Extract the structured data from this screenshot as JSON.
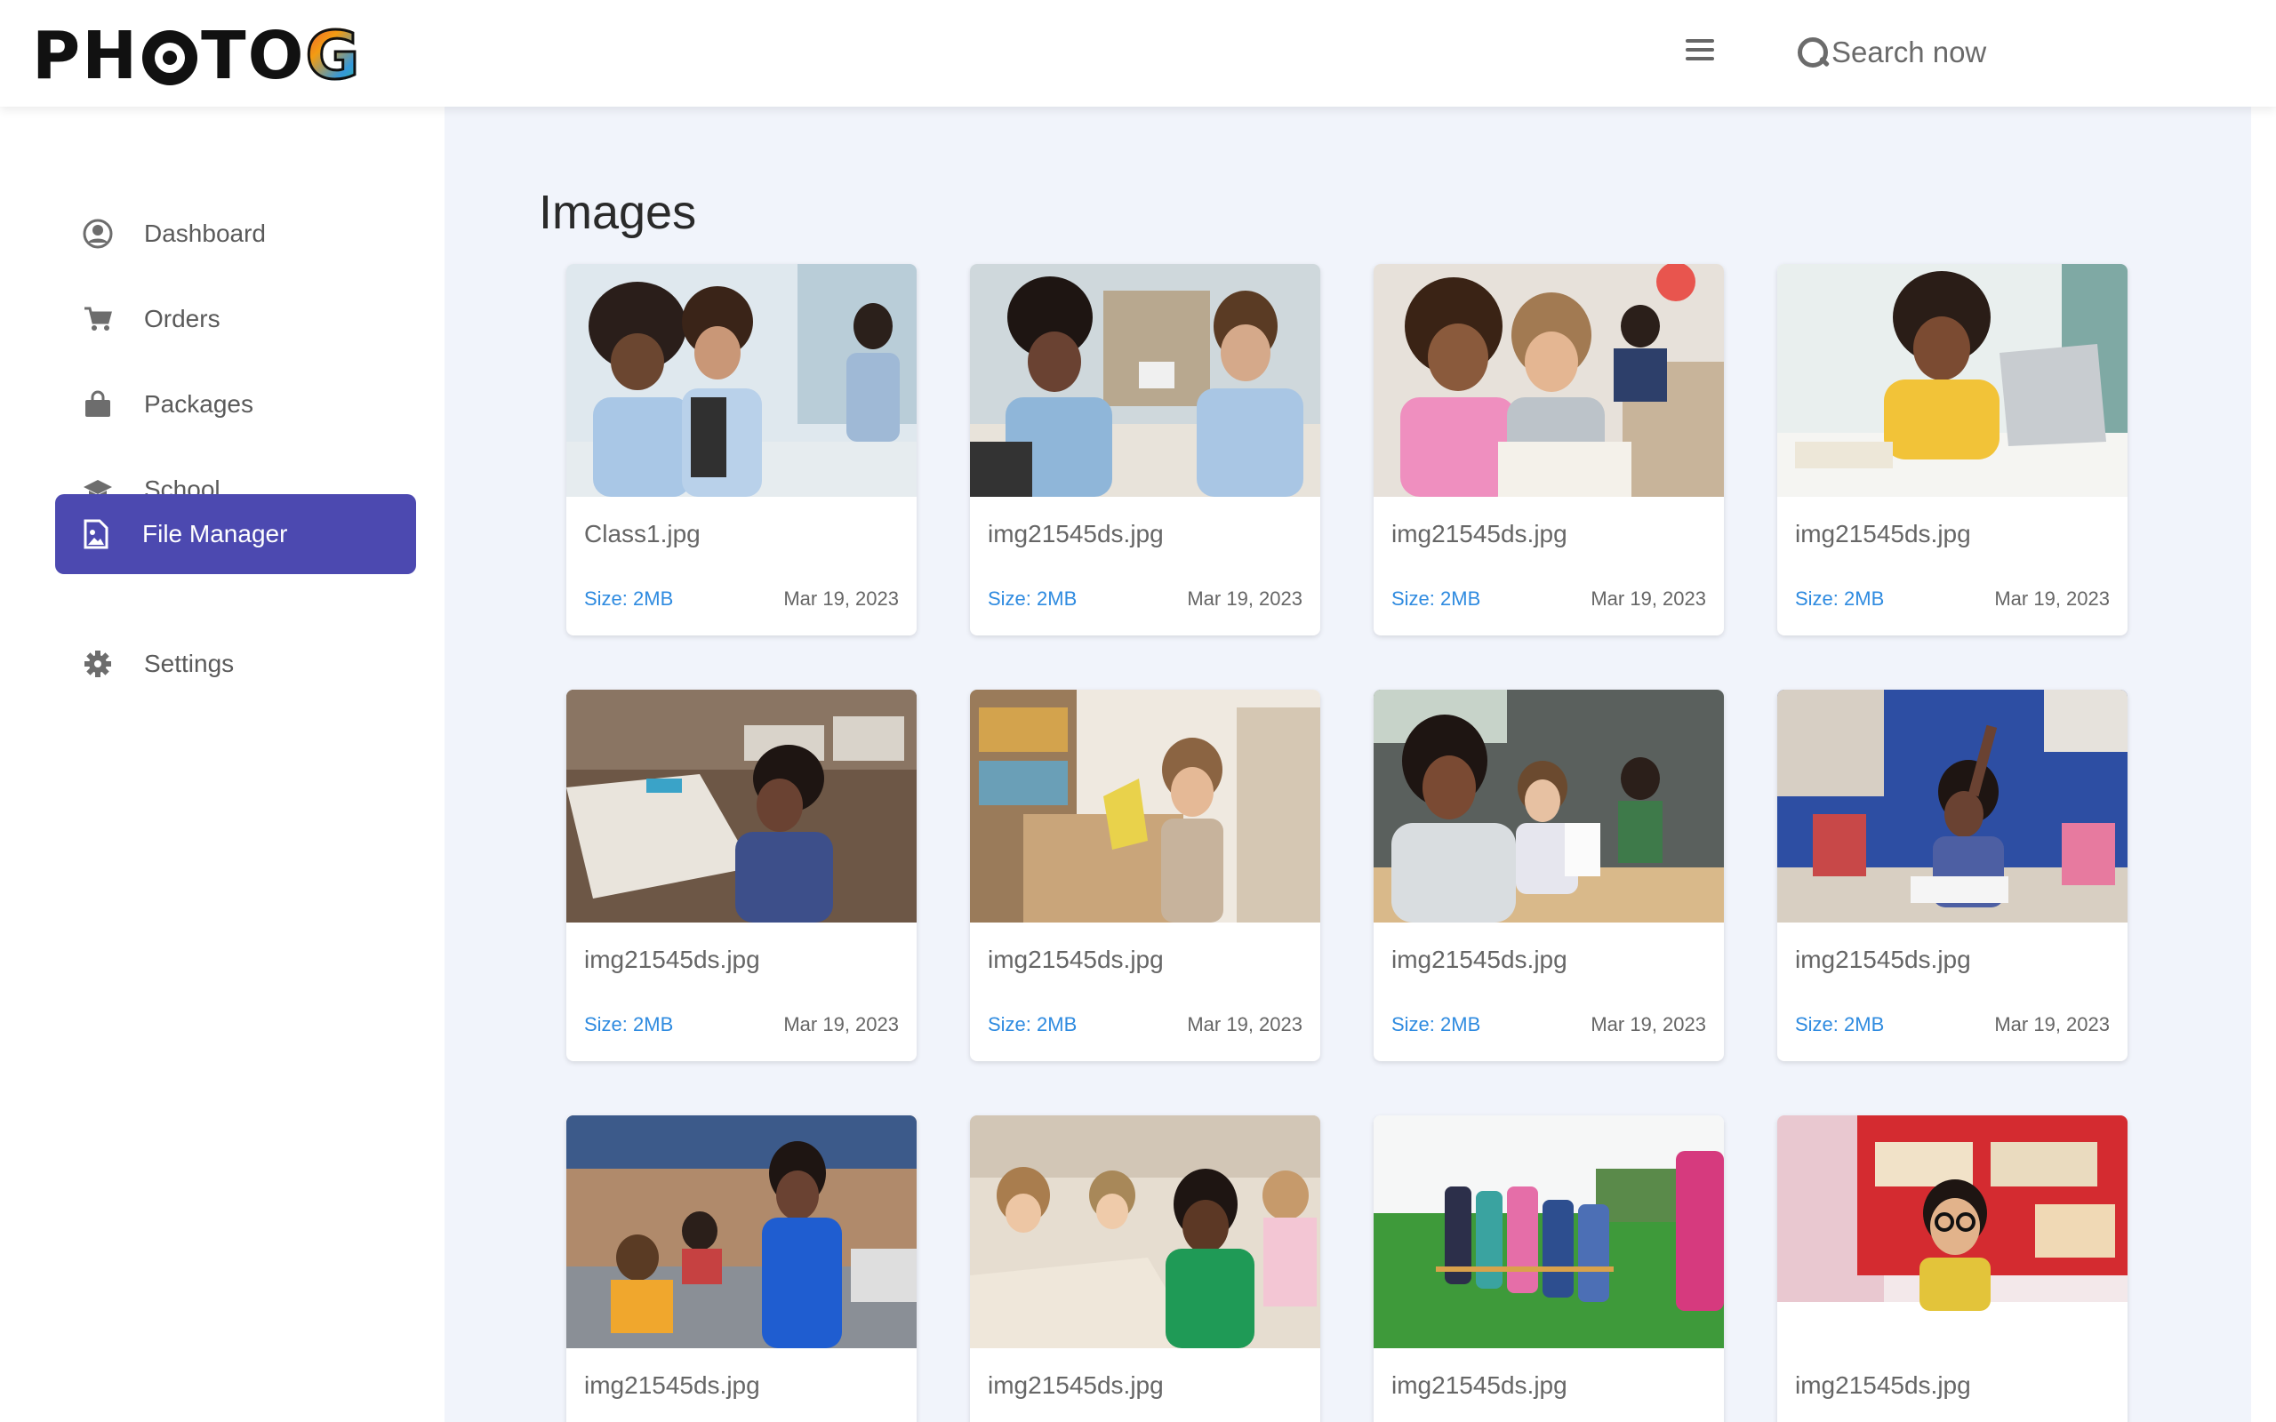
{
  "header": {
    "logo_text": "PHOTOG",
    "search_placeholder": "Search now"
  },
  "sidebar": {
    "items": [
      {
        "label": "Dashboard",
        "icon": "user-circle-icon",
        "active": false
      },
      {
        "label": "Orders",
        "icon": "cart-icon",
        "active": false
      },
      {
        "label": "Packages",
        "icon": "shopping-bag-icon",
        "active": false
      },
      {
        "label": "School",
        "icon": "graduation-cap-icon",
        "active": false
      },
      {
        "label": "File Manager",
        "icon": "file-image-icon",
        "active": true
      },
      {
        "label": "Settings",
        "icon": "gear-icon",
        "active": false
      }
    ]
  },
  "main": {
    "title": "Images",
    "images": [
      {
        "name": "Class1.jpg",
        "size": "Size: 2MB",
        "date": "Mar 19, 2023"
      },
      {
        "name": "img21545ds.jpg",
        "size": "Size: 2MB",
        "date": "Mar 19, 2023"
      },
      {
        "name": "img21545ds.jpg",
        "size": "Size: 2MB",
        "date": "Mar 19, 2023"
      },
      {
        "name": "img21545ds.jpg",
        "size": "Size: 2MB",
        "date": "Mar 19, 2023"
      },
      {
        "name": "img21545ds.jpg",
        "size": "Size: 2MB",
        "date": "Mar 19, 2023"
      },
      {
        "name": "img21545ds.jpg",
        "size": "Size: 2MB",
        "date": "Mar 19, 2023"
      },
      {
        "name": "img21545ds.jpg",
        "size": "Size: 2MB",
        "date": "Mar 19, 2023"
      },
      {
        "name": "img21545ds.jpg",
        "size": "Size: 2MB",
        "date": "Mar 19, 2023"
      },
      {
        "name": "img21545ds.jpg",
        "size": "",
        "date": ""
      },
      {
        "name": "img21545ds.jpg",
        "size": "",
        "date": ""
      },
      {
        "name": "img21545ds.jpg",
        "size": "",
        "date": ""
      },
      {
        "name": "img21545ds.jpg",
        "size": "",
        "date": ""
      }
    ]
  },
  "colors": {
    "accent": "#4c49b0",
    "link": "#2f8be0",
    "main_bg": "#f1f4fb"
  }
}
